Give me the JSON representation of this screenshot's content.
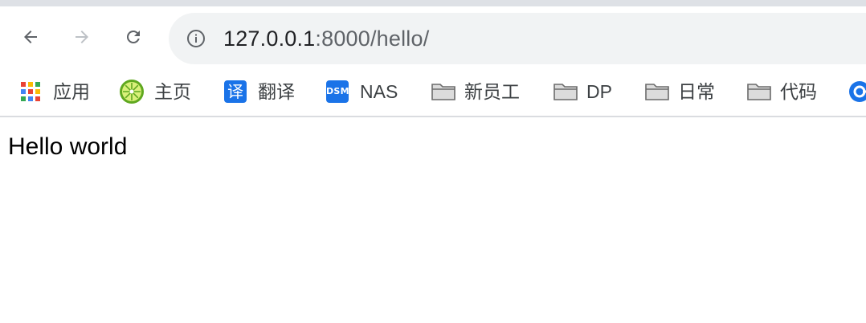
{
  "browser": {
    "url_host": "127.0.0.1",
    "url_path": ":8000/hello/",
    "nav": {
      "back_icon": "arrow-left-icon",
      "forward_icon": "arrow-right-icon",
      "reload_icon": "reload-icon",
      "info_icon": "info-icon"
    }
  },
  "bookmarks": [
    {
      "label": "应用",
      "icon": "apps-grid-icon"
    },
    {
      "label": "主页",
      "icon": "lime-icon"
    },
    {
      "label": "翻译",
      "icon": "translate-icon",
      "icon_text": "译"
    },
    {
      "label": "NAS",
      "icon": "dsm-icon",
      "icon_text": "DSM"
    },
    {
      "label": "新员工",
      "icon": "folder-icon"
    },
    {
      "label": "DP",
      "icon": "folder-icon"
    },
    {
      "label": "日常",
      "icon": "folder-icon"
    },
    {
      "label": "代码",
      "icon": "folder-icon"
    }
  ],
  "page": {
    "text": "Hello world"
  },
  "colors": {
    "accent": "#1a73e8",
    "omnibox_bg": "#f1f3f4",
    "frame": "#dee1e6"
  }
}
